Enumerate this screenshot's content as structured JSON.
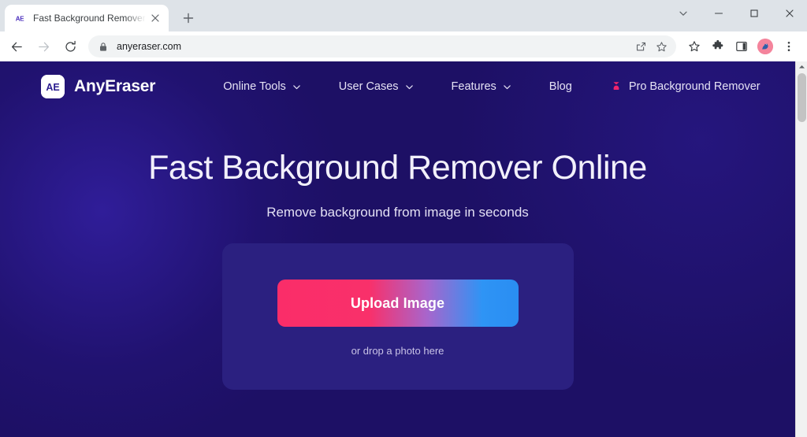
{
  "browser": {
    "tab": {
      "favicon_label": "AE",
      "title": "Fast Background Remover - R",
      "close_icon": "close-icon"
    },
    "new_tab_label": "+",
    "window_controls": {
      "tab_search": "chevron-down-icon",
      "minimize": "minimize-icon",
      "maximize": "maximize-icon",
      "close": "close-icon"
    },
    "toolbar": {
      "back": "back-arrow-icon",
      "forward": "forward-arrow-icon",
      "reload": "reload-icon",
      "site_security": "lock-icon",
      "url": "anyeraser.com",
      "share": "share-icon",
      "bookmark_this": "star-outline-icon",
      "bookmarks": "star-icon",
      "extensions": "puzzle-piece-icon",
      "side_panel": "side-panel-icon",
      "profile": "avatar-icon",
      "menu": "three-dot-menu-icon"
    }
  },
  "site": {
    "logo": {
      "mark": "AE",
      "name": "AnyEraser"
    },
    "nav": [
      {
        "label": "Online Tools",
        "has_dropdown": true
      },
      {
        "label": "User Cases",
        "has_dropdown": true
      },
      {
        "label": "Features",
        "has_dropdown": true
      },
      {
        "label": "Blog",
        "has_dropdown": false
      },
      {
        "label": "Pro Background Remover",
        "has_dropdown": false,
        "icon": "pro-badge-icon"
      }
    ],
    "hero": {
      "title": "Fast Background Remover Online",
      "subtitle": "Remove background from image in seconds"
    },
    "dropzone": {
      "upload_button": "Upload Image",
      "hint": "or drop a photo here"
    },
    "colors": {
      "page_background": "#1d1065",
      "dropzone_background": "#2b2080",
      "gradient_start": "#fa2d69",
      "gradient_end": "#2a8df2",
      "pro_badge": "#f2246b"
    }
  }
}
